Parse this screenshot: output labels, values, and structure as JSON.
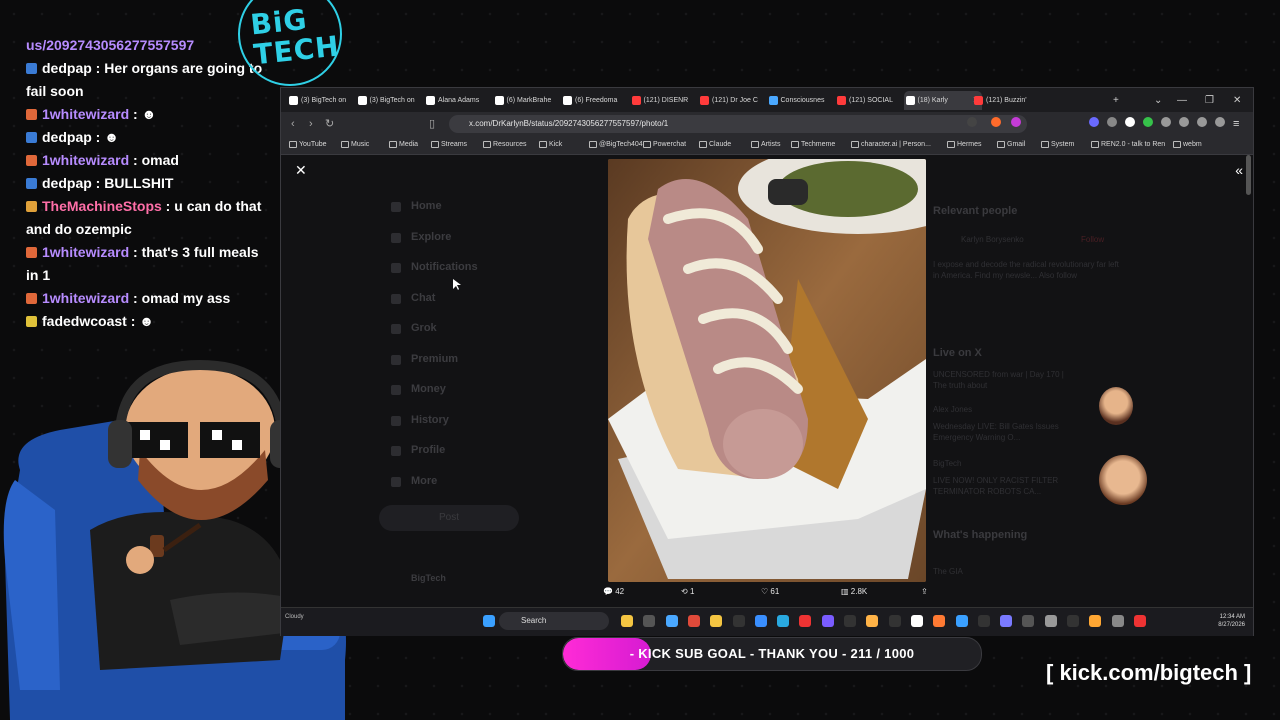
{
  "chat": {
    "topline": "us/2092743056277557597",
    "messages": [
      {
        "user": "dedpap",
        "text": "Her organs are going to fail soon",
        "color": "#ffffff",
        "badge": "#3a7bd5"
      },
      {
        "user": "1whitewizard",
        "text": "☻",
        "color": "#b78cff",
        "badge": "#e0683a"
      },
      {
        "user": "dedpap",
        "text": "☻",
        "color": "#ffffff",
        "badge": "#3a7bd5"
      },
      {
        "user": "1whitewizard",
        "text": "omad",
        "color": "#b78cff",
        "badge": "#e0683a"
      },
      {
        "user": "dedpap",
        "text": "BULLSHIT",
        "color": "#ffffff",
        "badge": "#3a7bd5"
      },
      {
        "user": "TheMachineStops",
        "text": "u can do that and do ozempic",
        "color": "#ff6fa8",
        "badge": "#e0a13a"
      },
      {
        "user": "1whitewizard",
        "text": "that's 3 full meals in 1",
        "color": "#b78cff",
        "badge": "#e0683a"
      },
      {
        "user": "1whitewizard",
        "text": "omad my ass",
        "color": "#b78cff",
        "badge": "#e0683a"
      },
      {
        "user": "fadedwcoast",
        "text": "☻",
        "color": "#ffffff",
        "badge": "#e0c23a"
      }
    ]
  },
  "logo": {
    "line1": "BiG",
    "line2": "TECH"
  },
  "browser": {
    "tabs": [
      {
        "label": "(3) BigTech on",
        "icon": "x-icon",
        "color": "#ffffff"
      },
      {
        "label": "(3) BigTech on",
        "icon": "x-icon",
        "color": "#ffffff"
      },
      {
        "label": "Alana Adams",
        "icon": "tiktok-icon",
        "color": "#ffffff"
      },
      {
        "label": "(6) MarkBrahe",
        "icon": "x-icon",
        "color": "#ffffff"
      },
      {
        "label": "(6) Freedoma",
        "icon": "x-icon",
        "color": "#ffffff"
      },
      {
        "label": "(121) DISENR",
        "icon": "youtube-icon",
        "color": "#ff3b3b"
      },
      {
        "label": "(121) Dr Joe C",
        "icon": "youtube-icon",
        "color": "#ff3b3b"
      },
      {
        "label": "Consciousnes",
        "icon": "slash-icon",
        "color": "#4aa8ff"
      },
      {
        "label": "(121) SOCIAL",
        "icon": "youtube-icon",
        "color": "#ff3b3b"
      },
      {
        "label": "(18) Karly",
        "icon": "x-icon",
        "color": "#ffffff"
      },
      {
        "label": "(121) Buzzin'",
        "icon": "youtube-icon",
        "color": "#ff3b3b"
      }
    ],
    "url": "x.com/DrKarlynB/status/2092743056277557597/photo/1",
    "bookmarks": [
      "YouTube",
      "Music",
      "Media",
      "Streams",
      "Resources",
      "Kick",
      "@BigTech404",
      "Powerchat",
      "Claude",
      "Artists",
      "Techmeme",
      "character.ai | Person...",
      "Hermes",
      "Gmail",
      "System",
      "REN2.0 - talk to Ren",
      "webm"
    ],
    "nav_items": [
      "Home",
      "Explore",
      "Notifications",
      "Chat",
      "Grok",
      "Premium",
      "Money",
      "History",
      "Profile",
      "More"
    ],
    "post_label": "Post",
    "account_label": "BigTech",
    "side": {
      "relevant": "Relevant people",
      "person": "Karlyn Borysenko",
      "follow": "Follow",
      "bio": "I expose and decode the radical revolutionary far left in America. Find my newsle... Also follow",
      "live": "Live on X",
      "live1": "UNCENSORED from war | Day 170 | The truth about",
      "live2_host": "Alex Jones",
      "live2": "Wednesday LIVE: Bill Gates Issues Emergency Warning O...",
      "live3_host": "BigTech",
      "live3": "LIVE NOW! ONLY RACIST FILTER TERMINATOR ROBOTS CA...",
      "happening": "What's happening",
      "trend": "The GIA"
    },
    "engagement": {
      "replies": "42",
      "reposts": "1",
      "likes": "61",
      "views": "2.8K"
    },
    "taskbar": {
      "search": "Search",
      "weather": "Cloudy",
      "time": "12:34 AM",
      "date": "8/27/2026"
    }
  },
  "goal": {
    "text": "- KICK SUB GOAL - THANK YOU - 211 / 1000",
    "current": 211,
    "target": 1000
  },
  "kick_link": "[ kick.com/bigtech ]"
}
